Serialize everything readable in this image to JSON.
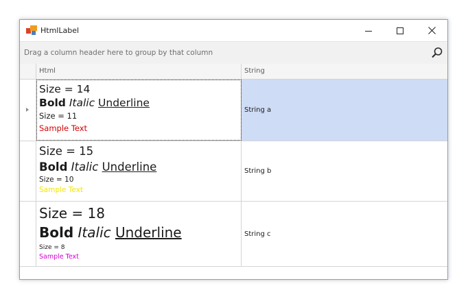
{
  "window": {
    "title": "HtmlLabel",
    "icon": "app-logo-icon",
    "controls": [
      "minimize-icon",
      "maximize-icon",
      "close-icon"
    ]
  },
  "group_panel": {
    "text": "Drag a column header here to group by that column",
    "search_icon": "search-icon"
  },
  "columns": {
    "html": "Html",
    "string": "String"
  },
  "rows": [
    {
      "size_line": "Size = 14",
      "bold": "Bold",
      "italic": "Italic",
      "underline": "Underline",
      "small_size_line": "Size = 11",
      "sample": "Sample Text",
      "sample_color": "#d40000",
      "string": "String a"
    },
    {
      "size_line": "Size = 15",
      "bold": "Bold",
      "italic": "Italic",
      "underline": "Underline",
      "small_size_line": "Size = 10",
      "sample": "Sample Text",
      "sample_color": "#f2e600",
      "string": "String b"
    },
    {
      "size_line": "Size = 18",
      "bold": "Bold",
      "italic": "Italic",
      "underline": "Underline",
      "small_size_line": "Size = 8",
      "sample": "Sample Text",
      "sample_color": "#d200d2",
      "string": "String c"
    }
  ],
  "colors": {
    "selection": "#cfdcf5",
    "logo_red": "#d9442a",
    "logo_orange": "#f29a1f",
    "logo_blue": "#4a7fc1"
  }
}
